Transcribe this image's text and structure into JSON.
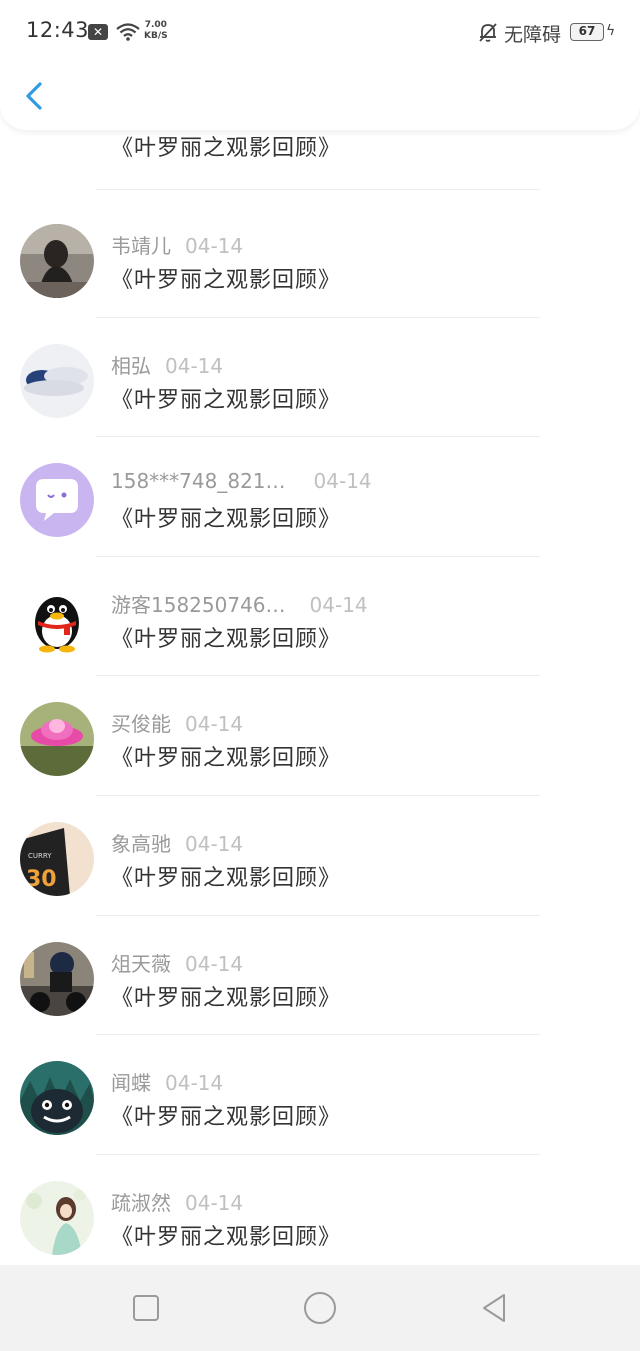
{
  "status_bar": {
    "time": "12:43",
    "notif_badge": "✕",
    "net_speed_value": "7.00",
    "net_speed_unit": "KB/S",
    "accessibility_label": "无障碍",
    "battery": "67"
  },
  "header": {
    "back_icon": "chevron-left-icon",
    "accent_color": "#2f9be6"
  },
  "messages": [
    {
      "name": "",
      "date": "",
      "title": "《叶罗丽之观影回顾》",
      "avatar": "partial-face-avatar"
    },
    {
      "name": "韦靖儿",
      "date": "04-14",
      "title": "《叶罗丽之观影回顾》",
      "avatar": "girl-photo-avatar"
    },
    {
      "name": "相弘",
      "date": "04-14",
      "title": "《叶罗丽之观影回顾》",
      "avatar": "sleeping-person-avatar"
    },
    {
      "name": "158***748_821…",
      "date": "04-14",
      "title": "《叶罗丽之观影回顾》",
      "avatar": "chat-bubble-avatar"
    },
    {
      "name": "游客158250746…",
      "date": "04-14",
      "title": "《叶罗丽之观影回顾》",
      "avatar": "qq-penguin-avatar"
    },
    {
      "name": "买俊能",
      "date": "04-14",
      "title": "《叶罗丽之观影回顾》",
      "avatar": "pink-flower-avatar"
    },
    {
      "name": "象高驰",
      "date": "04-14",
      "title": "《叶罗丽之观影回顾》",
      "avatar": "basketball-jersey-avatar"
    },
    {
      "name": "俎天薇",
      "date": "04-14",
      "title": "《叶罗丽之观影回顾》",
      "avatar": "motorcycle-avatar"
    },
    {
      "name": "闻蝶",
      "date": "04-14",
      "title": "《叶罗丽之观影回顾》",
      "avatar": "totoro-avatar"
    },
    {
      "name": "疏淑然",
      "date": "04-14",
      "title": "《叶罗丽之观影回顾》",
      "avatar": "girl-illustration-avatar"
    }
  ],
  "nav_bar": {
    "recents": "square-icon",
    "home": "circle-icon",
    "back": "triangle-back-icon"
  }
}
